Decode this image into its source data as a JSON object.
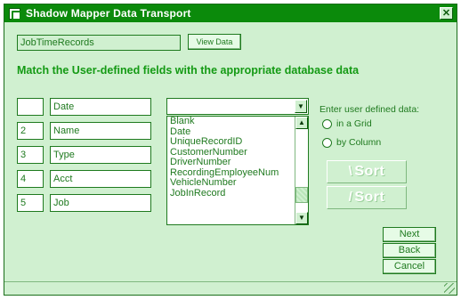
{
  "window": {
    "title": "Shadow Mapper Data Transport",
    "close_glyph": "✕"
  },
  "record": {
    "value": "JobTimeRecords",
    "view_button_label": "View Data"
  },
  "instruction": "Match the User-defined fields with the appropriate database data",
  "rows": [
    {
      "number": "",
      "name": "Date"
    },
    {
      "number": "2",
      "name": "Name"
    },
    {
      "number": "3",
      "name": "Type"
    },
    {
      "number": "4",
      "name": "Acct"
    },
    {
      "number": "5",
      "name": "Job"
    }
  ],
  "mapping_combo": {
    "value": "",
    "options": [
      "Blank",
      "Date",
      "UniqueRecordID",
      "CustomerNumber",
      "DriverNumber",
      "RecordingEmployeeNum",
      "VehicleNumber",
      "JobInRecord"
    ]
  },
  "entry_mode": {
    "label": "Enter user defined data:",
    "options": [
      "in a Grid",
      "by Column"
    ]
  },
  "sort_buttons": [
    {
      "label": "Sort",
      "glyph": "\\"
    },
    {
      "label": "Sort",
      "glyph": "/"
    }
  ],
  "nav": {
    "next": "Next",
    "back": "Back",
    "cancel": "Cancel"
  },
  "icons": {
    "app": "app-icon",
    "close": "close-icon",
    "dropdown": "chevron-down-icon",
    "scroll_up": "scroll-up-icon",
    "scroll_down": "scroll-down-icon"
  },
  "colors": {
    "titlebar": "#0b8a0b",
    "background": "#d0f0d0",
    "text": "#1f7a1f",
    "heading": "#149a14"
  }
}
